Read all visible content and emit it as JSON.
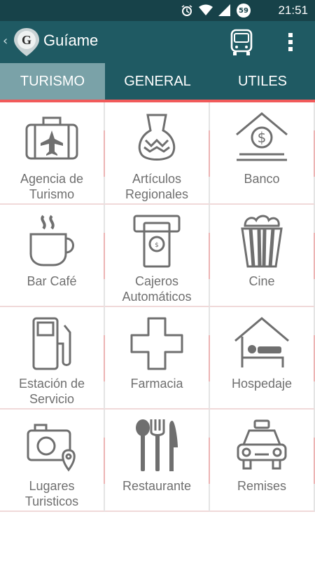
{
  "statusbar": {
    "time": "21:51",
    "badge": "59",
    "icons": [
      "alarm-icon",
      "wifi-icon",
      "signal-icon",
      "notification-badge"
    ]
  },
  "appbar": {
    "title": "Guíame",
    "logo_letter": "G",
    "icons": [
      "back-chevron-icon",
      "bus-icon",
      "more-vert-icon"
    ]
  },
  "tabs": [
    {
      "label": "TURISMO",
      "active": true
    },
    {
      "label": "GENERAL",
      "active": false
    },
    {
      "label": "UTILES",
      "active": false
    }
  ],
  "grid": [
    {
      "label": "Agencia de\nTurismo",
      "icon": "suitcase-plane-icon"
    },
    {
      "label": "Artículos\nRegionales",
      "icon": "vase-icon"
    },
    {
      "label": "Banco",
      "icon": "bank-icon"
    },
    {
      "label": "Bar Café",
      "icon": "coffee-cup-icon"
    },
    {
      "label": "Cajeros\nAutomáticos",
      "icon": "atm-icon"
    },
    {
      "label": "Cine",
      "icon": "popcorn-icon"
    },
    {
      "label": "Estación de\nServicio",
      "icon": "gas-pump-icon"
    },
    {
      "label": "Farmacia",
      "icon": "cross-icon"
    },
    {
      "label": "Hospedaje",
      "icon": "house-bed-icon"
    },
    {
      "label": "Lugares\nTuristicos",
      "icon": "camera-pin-icon"
    },
    {
      "label": "Restaurante",
      "icon": "cutlery-icon"
    },
    {
      "label": "Remises",
      "icon": "taxi-icon"
    }
  ],
  "colors": {
    "statusbar": "#174249",
    "appbar": "#1f5a63",
    "tab_active": "#7aa2a8",
    "accent": "#f15a5a",
    "icon_gray": "#6f6f6f"
  }
}
